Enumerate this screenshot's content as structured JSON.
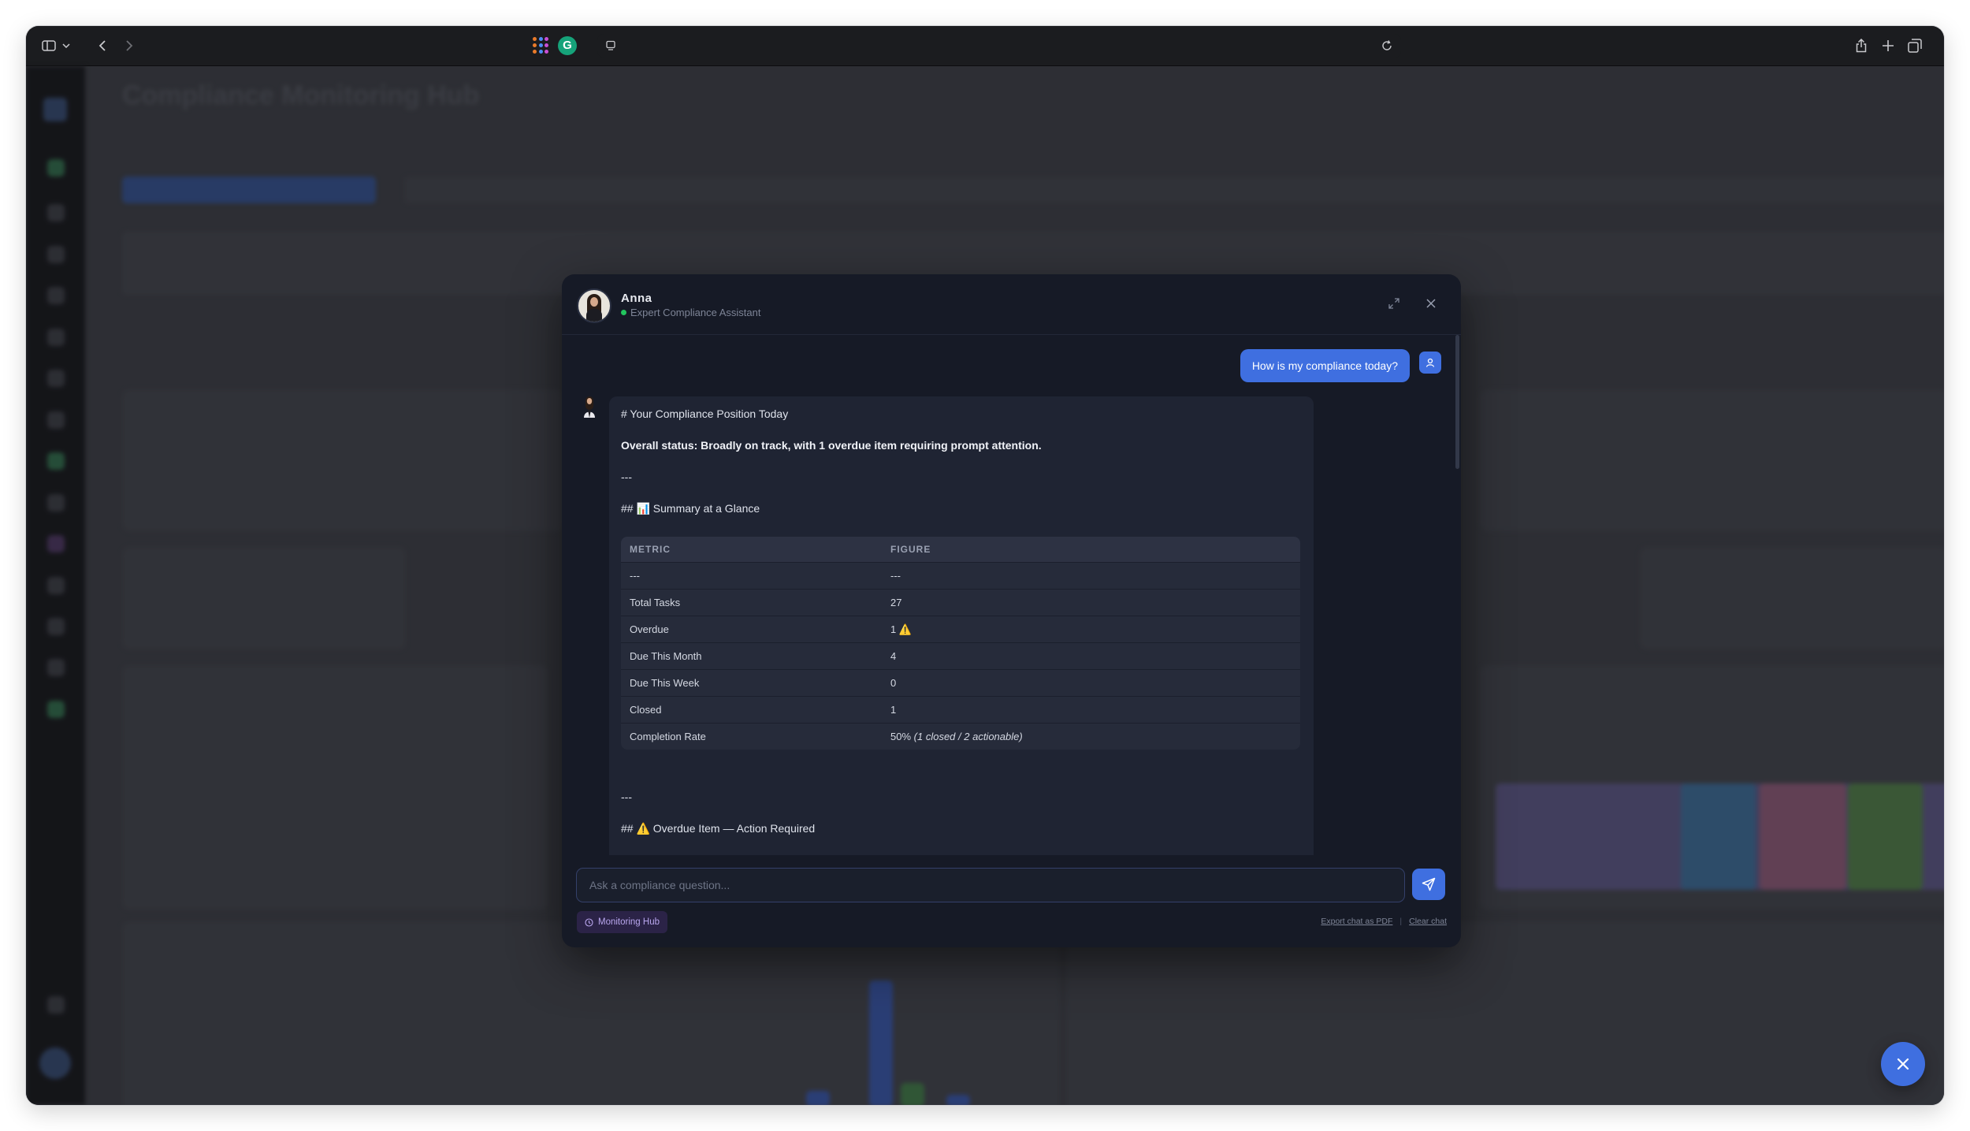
{
  "chat": {
    "assistant_name": "Anna",
    "assistant_role": "Expert Compliance Assistant",
    "user_message": "How is my compliance today?",
    "response": {
      "heading": "# Your Compliance Position Today",
      "overall_status": "Overall status: Broadly on track, with 1 overdue item requiring prompt attention.",
      "divider1": "---",
      "summary_heading": "## 📊 Summary at a Glance",
      "table": {
        "headers": [
          "METRIC",
          "FIGURE"
        ],
        "rows": [
          [
            "---",
            "---"
          ],
          [
            "Total Tasks",
            "27"
          ],
          [
            "Overdue",
            "1 ⚠️"
          ],
          [
            "Due This Month",
            "4"
          ],
          [
            "Due This Week",
            "0"
          ],
          [
            "Closed",
            "1"
          ],
          [
            "Completion Rate",
            "50%",
            "(1 closed / 2 actionable)"
          ]
        ]
      },
      "divider2": "---",
      "overdue_heading": "## ⚠️ Overdue Item — Action Required"
    },
    "input_placeholder": "Ask a compliance question...",
    "context_chip": "Monitoring Hub",
    "export_label": "Export chat as PDF",
    "separator": "|",
    "clear_label": "Clear chat"
  },
  "background": {
    "page_title": "Compliance Monitoring Hub"
  },
  "colors": {
    "accent": "#3f6fe0",
    "modal_bg": "#161a26",
    "online": "#22c55e"
  }
}
